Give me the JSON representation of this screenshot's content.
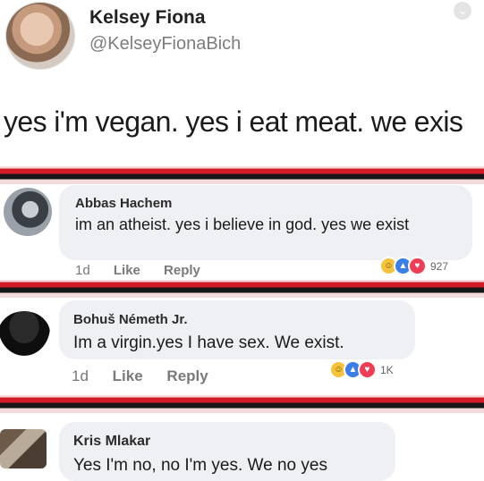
{
  "tweet": {
    "name": "Kelsey Fiona",
    "handle": "@KelseyFionaBich",
    "text": "yes i'm vegan. yes i eat meat. we exis",
    "menu_icon": "chevron-down-icon"
  },
  "comments": [
    {
      "name": "Abbas Hachem",
      "text": "im an atheist.  yes i believe in god.  yes we exist",
      "time": "1d",
      "like_label": "Like",
      "reply_label": "Reply",
      "reaction_count": "927",
      "reactions": [
        "haha-icon",
        "like-icon",
        "love-icon"
      ]
    },
    {
      "name": "Bohuš Németh Jr.",
      "text": "Im a virgin.yes I have sex. We exist.",
      "time": "1d",
      "like_label": "Like",
      "reply_label": "Reply",
      "reaction_count": "1K",
      "reactions": [
        "haha-icon",
        "like-icon",
        "love-icon"
      ]
    },
    {
      "name": "Kris Mlakar",
      "text": "Yes I'm no, no I'm yes. We no yes"
    }
  ],
  "colors": {
    "divider_red": "#d11b27",
    "divider_black": "#161616",
    "bubble_bg": "#eef0f3",
    "like_blue": "#3b7ee8",
    "love_red": "#ef3d56",
    "haha_yellow": "#f5c33b"
  }
}
